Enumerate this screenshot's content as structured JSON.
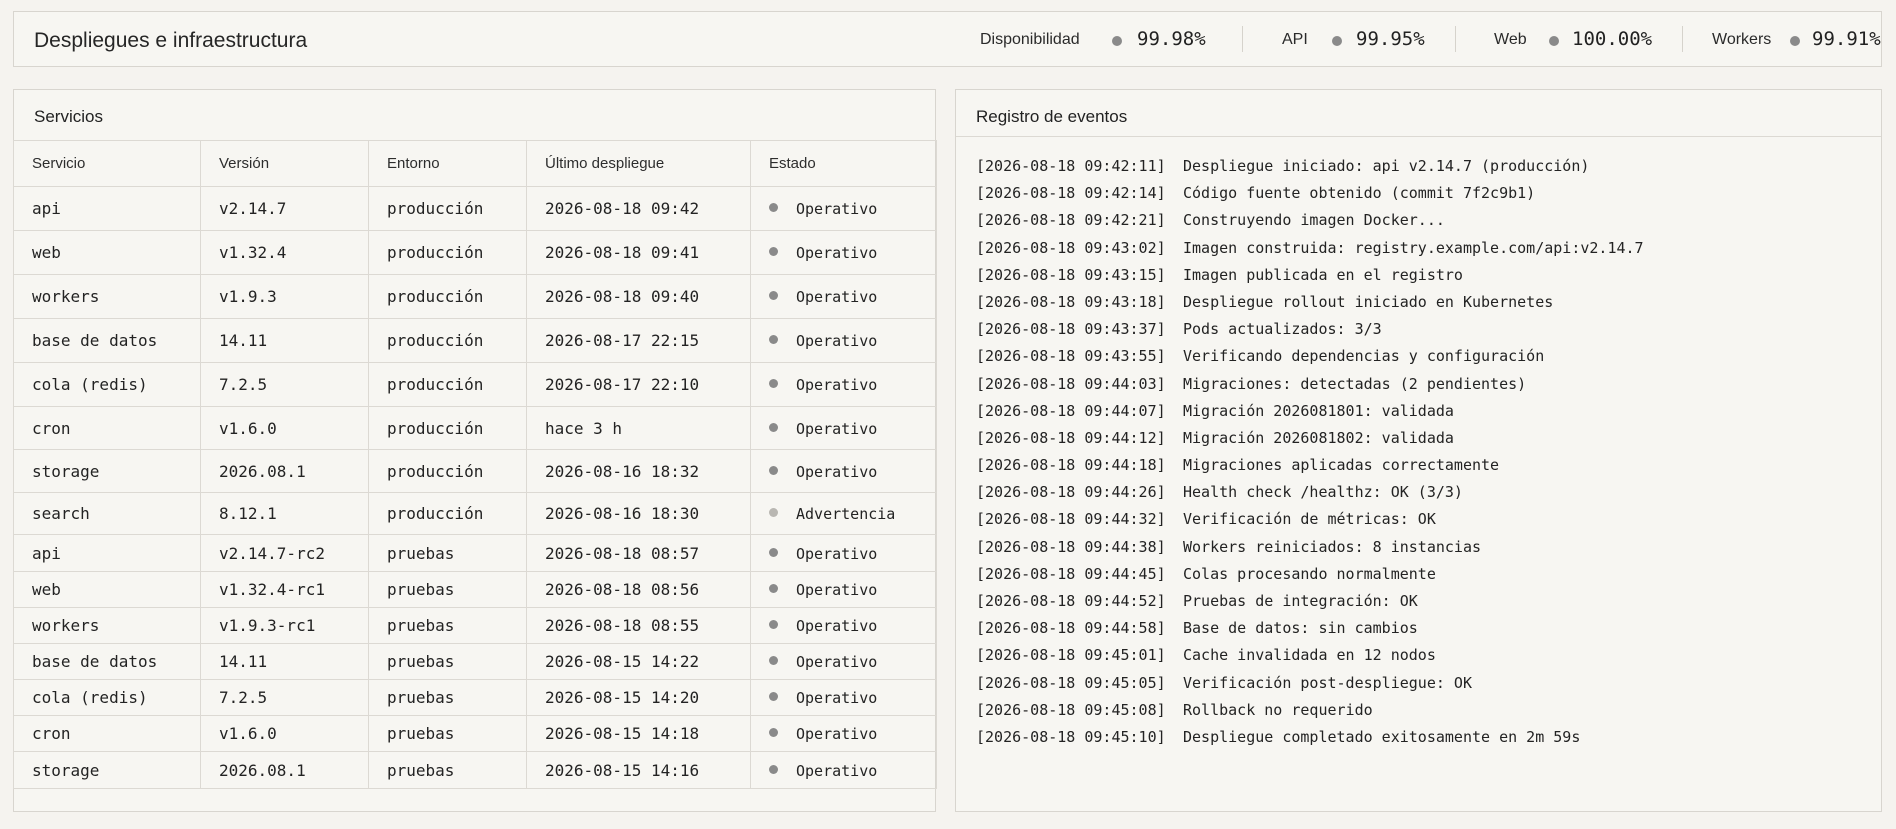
{
  "header": {
    "title": "Despliegues e infraestructura",
    "metrics": [
      {
        "label": "Disponibilidad",
        "value": "99.98%"
      },
      {
        "label": "API",
        "value": "99.95%"
      },
      {
        "label": "Web",
        "value": "100.00%"
      },
      {
        "label": "Workers",
        "value": "99.91%"
      }
    ]
  },
  "services": {
    "title": "Servicios",
    "columns": [
      "Servicio",
      "Versión",
      "Entorno",
      "Último despliegue",
      "Estado"
    ],
    "rows": [
      {
        "service": "api",
        "version": "v2.14.7",
        "env": "producción",
        "last": "2026-08-18 09:42",
        "status": "Operativo"
      },
      {
        "service": "web",
        "version": "v1.32.4",
        "env": "producción",
        "last": "2026-08-18 09:41",
        "status": "Operativo"
      },
      {
        "service": "workers",
        "version": "v1.9.3",
        "env": "producción",
        "last": "2026-08-18 09:40",
        "status": "Operativo"
      },
      {
        "service": "base de datos",
        "version": "14.11",
        "env": "producción",
        "last": "2026-08-17 22:15",
        "status": "Operativo"
      },
      {
        "service": "cola (redis)",
        "version": "7.2.5",
        "env": "producción",
        "last": "2026-08-17 22:10",
        "status": "Operativo"
      },
      {
        "service": "cron",
        "version": "v1.6.0",
        "env": "producción",
        "last": "hace 3 h",
        "status": "Operativo"
      },
      {
        "service": "storage",
        "version": "2026.08.1",
        "env": "producción",
        "last": "2026-08-16 18:32",
        "status": "Operativo"
      },
      {
        "service": "search",
        "version": "8.12.1",
        "env": "producción",
        "last": "2026-08-16 18:30",
        "status": "Advertencia"
      },
      {
        "service": "api",
        "version": "v2.14.7-rc2",
        "env": "pruebas",
        "last": "2026-08-18 08:57",
        "status": "Operativo"
      },
      {
        "service": "web",
        "version": "v1.32.4-rc1",
        "env": "pruebas",
        "last": "2026-08-18 08:56",
        "status": "Operativo"
      },
      {
        "service": "workers",
        "version": "v1.9.3-rc1",
        "env": "pruebas",
        "last": "2026-08-18 08:55",
        "status": "Operativo"
      },
      {
        "service": "base de datos",
        "version": "14.11",
        "env": "pruebas",
        "last": "2026-08-15 14:22",
        "status": "Operativo"
      },
      {
        "service": "cola (redis)",
        "version": "7.2.5",
        "env": "pruebas",
        "last": "2026-08-15 14:20",
        "status": "Operativo"
      },
      {
        "service": "cron",
        "version": "v1.6.0",
        "env": "pruebas",
        "last": "2026-08-15 14:18",
        "status": "Operativo"
      },
      {
        "service": "storage",
        "version": "2026.08.1",
        "env": "pruebas",
        "last": "2026-08-15 14:16",
        "status": "Operativo"
      }
    ]
  },
  "events": {
    "title": "Registro de eventos",
    "entries": [
      {
        "ts": "[2026-08-18 09:42:11]",
        "msg": "Despliegue iniciado: api v2.14.7 (producción)"
      },
      {
        "ts": "[2026-08-18 09:42:14]",
        "msg": "Código fuente obtenido (commit 7f2c9b1)"
      },
      {
        "ts": "[2026-08-18 09:42:21]",
        "msg": "Construyendo imagen Docker..."
      },
      {
        "ts": "[2026-08-18 09:43:02]",
        "msg": "Imagen construida: registry.example.com/api:v2.14.7"
      },
      {
        "ts": "[2026-08-18 09:43:15]",
        "msg": "Imagen publicada en el registro"
      },
      {
        "ts": "[2026-08-18 09:43:18]",
        "msg": "Despliegue rollout iniciado en Kubernetes"
      },
      {
        "ts": "[2026-08-18 09:43:37]",
        "msg": "Pods actualizados: 3/3"
      },
      {
        "ts": "[2026-08-18 09:43:55]",
        "msg": "Verificando dependencias y configuración"
      },
      {
        "ts": "[2026-08-18 09:44:03]",
        "msg": "Migraciones: detectadas (2 pendientes)"
      },
      {
        "ts": "[2026-08-18 09:44:07]",
        "msg": "Migración 2026081801: validada"
      },
      {
        "ts": "[2026-08-18 09:44:12]",
        "msg": "Migración 2026081802: validada"
      },
      {
        "ts": "[2026-08-18 09:44:18]",
        "msg": "Migraciones aplicadas correctamente"
      },
      {
        "ts": "[2026-08-18 09:44:26]",
        "msg": "Health check /healthz: OK (3/3)"
      },
      {
        "ts": "[2026-08-18 09:44:32]",
        "msg": "Verificación de métricas: OK"
      },
      {
        "ts": "[2026-08-18 09:44:38]",
        "msg": "Workers reiniciados: 8 instancias"
      },
      {
        "ts": "[2026-08-18 09:44:45]",
        "msg": "Colas procesando normalmente"
      },
      {
        "ts": "[2026-08-18 09:44:52]",
        "msg": "Pruebas de integración: OK"
      },
      {
        "ts": "[2026-08-18 09:44:58]",
        "msg": "Base de datos: sin cambios"
      },
      {
        "ts": "[2026-08-18 09:45:01]",
        "msg": "Cache invalidada en 12 nodos"
      },
      {
        "ts": "[2026-08-18 09:45:05]",
        "msg": "Verificación post-despliegue: OK"
      },
      {
        "ts": "[2026-08-18 09:45:08]",
        "msg": "Rollback no requerido"
      },
      {
        "ts": "[2026-08-18 09:45:10]",
        "msg": "Despliegue completado exitosamente en 2m 59s"
      }
    ]
  }
}
